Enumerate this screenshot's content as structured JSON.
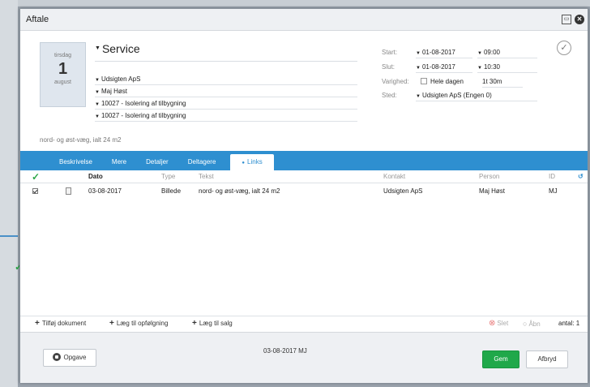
{
  "dialog": {
    "title": "Aftale"
  },
  "date": {
    "weekday": "tirsdag",
    "day": "1",
    "month": "august"
  },
  "appointment": {
    "subject": "Service",
    "customer": "Udsigten ApS",
    "person": "Maj Høst",
    "project": "10027 - Isolering af tilbygning",
    "task": "10027 - Isolering af tilbygning",
    "description": "nord- og øst-væg, ialt 24 m2"
  },
  "time": {
    "start_label": "Start:",
    "start_date": "01-08-2017",
    "start_time": "09:00",
    "end_label": "Slut:",
    "end_date": "01-08-2017",
    "end_time": "10:30",
    "duration_label": "Varighed:",
    "allday_label": "Hele dagen",
    "duration": "1t 30m",
    "place_label": "Sted:",
    "place": "Udsigten ApS (Engen 0)"
  },
  "tabs": [
    "Beskrivelse",
    "Mere",
    "Detaljer",
    "Deltagere",
    "Links"
  ],
  "tab_active_marker": "●",
  "grid": {
    "headers": {
      "date": "Dato",
      "type": "Type",
      "text": "Tekst",
      "contact": "Kontakt",
      "person": "Person",
      "id": "ID"
    },
    "rows": [
      {
        "date": "03-08-2017",
        "type": "Billede",
        "text": "nord- og øst-væg, ialt 24 m2",
        "contact": "Udsigten ApS",
        "person": "Maj Høst",
        "id": "MJ"
      }
    ]
  },
  "actions": {
    "add_document": "Tilføj dokument",
    "add_followup": "Læg til opfølgning",
    "add_sale": "Læg til salg",
    "delete": "Slet",
    "open": "Åbn",
    "count": "antal: 1"
  },
  "footer": {
    "task_button": "Opgave",
    "stamp": "03-08-2017 MJ",
    "save": "Gem",
    "cancel": "Afbryd"
  },
  "colors": {
    "accent": "#2e8fd0",
    "save": "#20a84a"
  }
}
